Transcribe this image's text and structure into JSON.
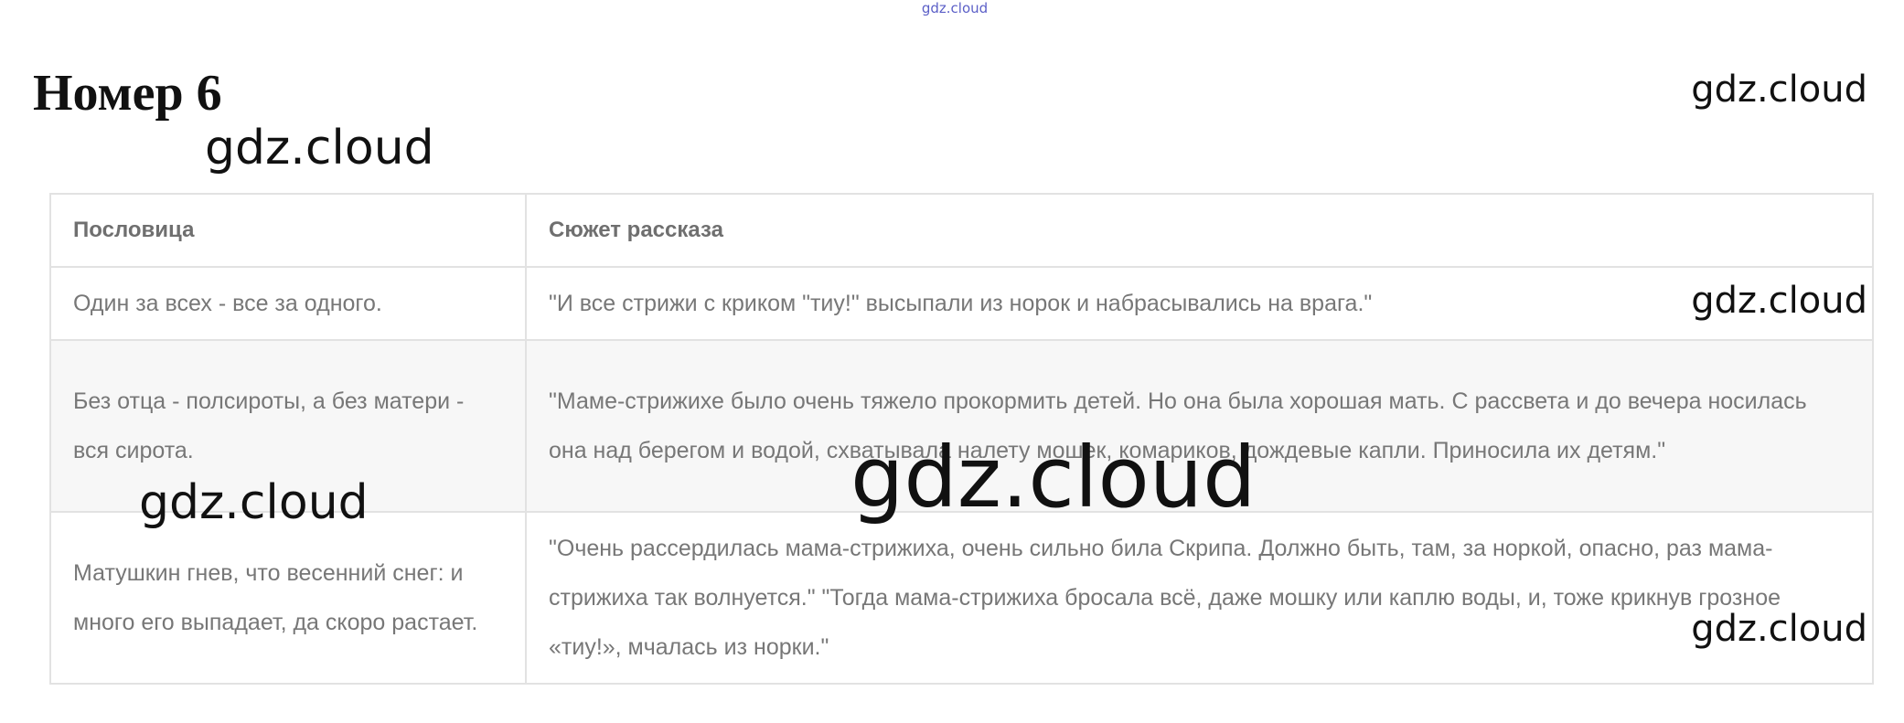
{
  "header": {
    "top_link": "gdz.cloud",
    "title": "Номер 6"
  },
  "watermark": "gdz.cloud",
  "table": {
    "columns": [
      "Пословица",
      "Сюжет рассказа"
    ],
    "rows": [
      {
        "proverb": "Один за всех - все за одного.",
        "plot": "\"И все стрижи с криком \"тиу!\" высыпали из норок и набрасывались на врага.\""
      },
      {
        "proverb": "Без отца - полсироты, а без матери - вся сирота.",
        "plot": "\"Маме-стрижихе было очень тяжело прокормить детей. Но она была хорошая мать. С рассвета и до вечера носилась она над берегом и водой, схватывала налету мошек, комариков, дождевые капли. Приносила их детям.\""
      },
      {
        "proverb": "Матушкин гнев, что весенний снег: и много его выпадает, да скоро растает.",
        "plot": "\"Очень рассердилась мама-стрижиха, очень сильно била Скрипа. Должно быть, там, за норкой, опасно, раз мама-стрижиха так волнуется.\" \"Тогда мама-стрижиха бросала всё, даже мошку или каплю воды, и, тоже крикнув грозное «тиу!», мчалась из норки.\""
      }
    ]
  }
}
